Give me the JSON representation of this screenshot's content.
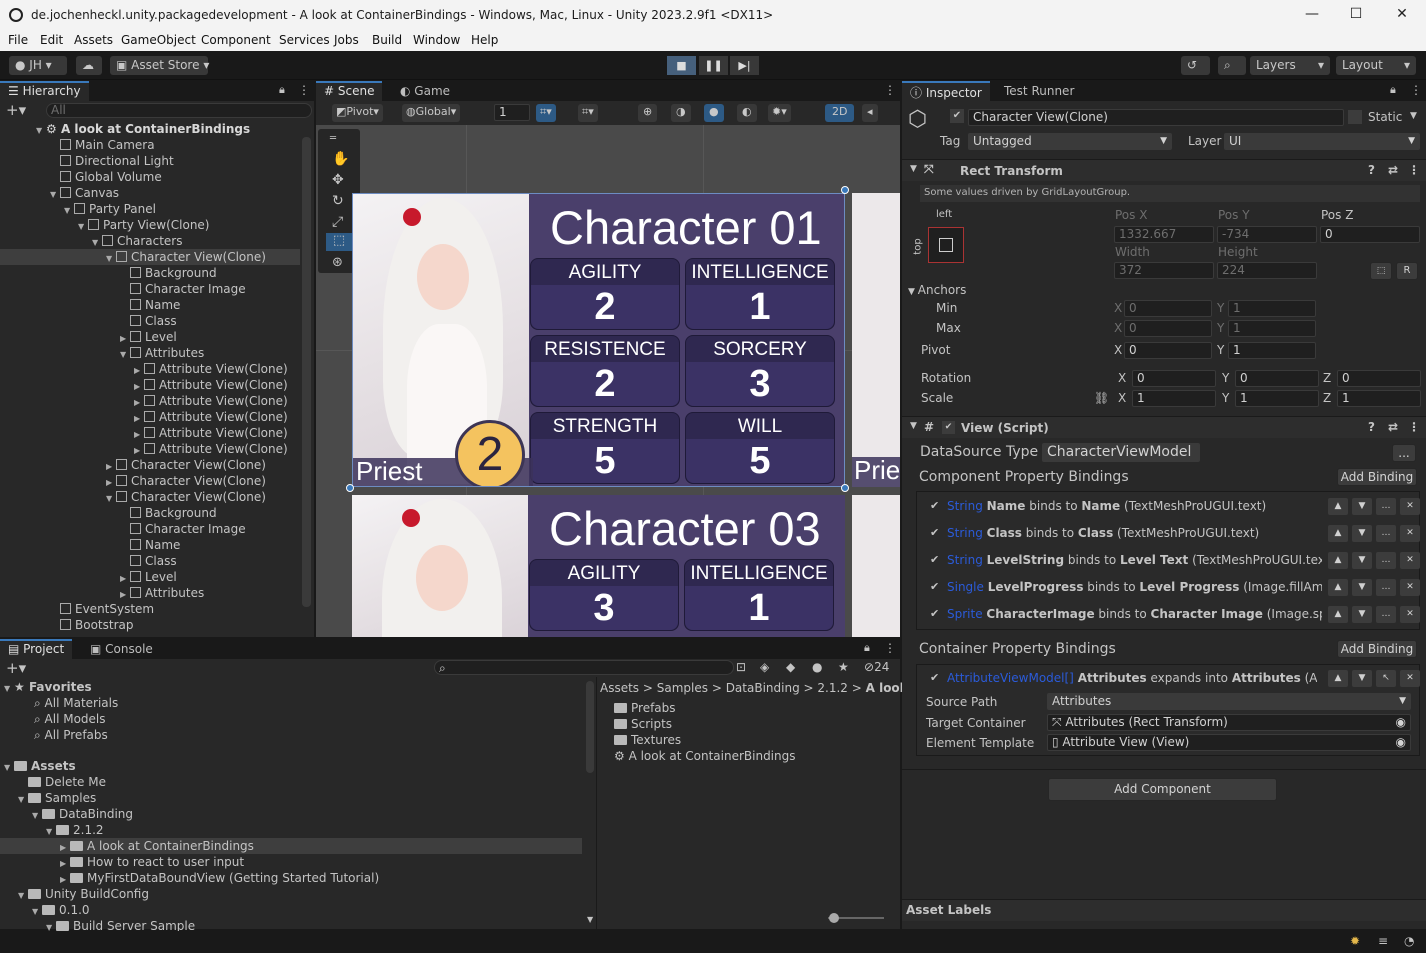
{
  "window": {
    "title": "de.jochenheckl.unity.packagedevelopment - A look at ContainerBindings - Windows, Mac, Linux - Unity 2023.2.9f1 <DX11>",
    "min": "—",
    "max": "☐",
    "close": "✕"
  },
  "menu": [
    "File",
    "Edit",
    "Assets",
    "GameObject",
    "Component",
    "Services",
    "Jobs",
    "Build",
    "Window",
    "Help"
  ],
  "toolbar": {
    "account": "JH",
    "asset_store": "Asset Store",
    "layers": "Layers",
    "layout": "Layout"
  },
  "hierarchy": {
    "tab": "Hierarchy",
    "search_placeholder": "All",
    "scene": "A look at ContainerBindings",
    "items": [
      {
        "label": "Main Camera",
        "depth": 1,
        "arrow": ""
      },
      {
        "label": "Directional Light",
        "depth": 1,
        "arrow": ""
      },
      {
        "label": "Global Volume",
        "depth": 1,
        "arrow": ""
      },
      {
        "label": "Canvas",
        "depth": 1,
        "arrow": "▼"
      },
      {
        "label": "Party Panel",
        "depth": 2,
        "arrow": "▼"
      },
      {
        "label": "Party View(Clone)",
        "depth": 3,
        "arrow": "▼"
      },
      {
        "label": "Characters",
        "depth": 4,
        "arrow": "▼"
      },
      {
        "label": "Character View(Clone)",
        "depth": 5,
        "arrow": "▼",
        "selected": true
      },
      {
        "label": "Background",
        "depth": 6,
        "arrow": ""
      },
      {
        "label": "Character Image",
        "depth": 6,
        "arrow": ""
      },
      {
        "label": "Name",
        "depth": 6,
        "arrow": ""
      },
      {
        "label": "Class",
        "depth": 6,
        "arrow": ""
      },
      {
        "label": "Level",
        "depth": 6,
        "arrow": "▶"
      },
      {
        "label": "Attributes",
        "depth": 6,
        "arrow": "▼"
      },
      {
        "label": "Attribute View(Clone)",
        "depth": 7,
        "arrow": "▶"
      },
      {
        "label": "Attribute View(Clone)",
        "depth": 7,
        "arrow": "▶"
      },
      {
        "label": "Attribute View(Clone)",
        "depth": 7,
        "arrow": "▶"
      },
      {
        "label": "Attribute View(Clone)",
        "depth": 7,
        "arrow": "▶"
      },
      {
        "label": "Attribute View(Clone)",
        "depth": 7,
        "arrow": "▶"
      },
      {
        "label": "Attribute View(Clone)",
        "depth": 7,
        "arrow": "▶"
      },
      {
        "label": "Character View(Clone)",
        "depth": 5,
        "arrow": "▶"
      },
      {
        "label": "Character View(Clone)",
        "depth": 5,
        "arrow": "▶"
      },
      {
        "label": "Character View(Clone)",
        "depth": 5,
        "arrow": "▼"
      },
      {
        "label": "Background",
        "depth": 6,
        "arrow": ""
      },
      {
        "label": "Character Image",
        "depth": 6,
        "arrow": ""
      },
      {
        "label": "Name",
        "depth": 6,
        "arrow": ""
      },
      {
        "label": "Class",
        "depth": 6,
        "arrow": ""
      },
      {
        "label": "Level",
        "depth": 6,
        "arrow": "▶"
      },
      {
        "label": "Attributes",
        "depth": 6,
        "arrow": "▶"
      },
      {
        "label": "EventSystem",
        "depth": 1,
        "arrow": ""
      },
      {
        "label": "Bootstrap",
        "depth": 1,
        "arrow": ""
      }
    ]
  },
  "scene": {
    "tab_scene": "Scene",
    "tab_game": "Game",
    "pivot": "Pivot",
    "global": "Global",
    "grid_value": "1",
    "mode_2d": "2D",
    "cards": [
      {
        "title": "Character 01",
        "class": "Priest",
        "level": "2",
        "stats": [
          {
            "k": "AGILITY",
            "v": "2"
          },
          {
            "k": "INTELLIGENCE",
            "v": "1"
          },
          {
            "k": "RESISTENCE",
            "v": "2"
          },
          {
            "k": "SORCERY",
            "v": "3"
          },
          {
            "k": "STRENGTH",
            "v": "5"
          },
          {
            "k": "WILL",
            "v": "5"
          }
        ]
      },
      {
        "title": "Character 03",
        "stats": [
          {
            "k": "AGILITY",
            "v": "3"
          },
          {
            "k": "INTELLIGENCE",
            "v": "1"
          }
        ]
      }
    ],
    "side_class": "Prie"
  },
  "project": {
    "tab_project": "Project",
    "tab_console": "Console",
    "hidden_count": "24",
    "favorites_label": "Favorites",
    "favorites": [
      "All Materials",
      "All Models",
      "All Prefabs"
    ],
    "assets_label": "Assets",
    "tree": [
      {
        "label": "Delete Me",
        "depth": 1,
        "arrow": ""
      },
      {
        "label": "Samples",
        "depth": 1,
        "arrow": "▼"
      },
      {
        "label": "DataBinding",
        "depth": 2,
        "arrow": "▼"
      },
      {
        "label": "2.1.2",
        "depth": 3,
        "arrow": "▼"
      },
      {
        "label": "A look at ContainerBindings",
        "depth": 4,
        "arrow": "▶",
        "selected": true
      },
      {
        "label": "How to react to user input",
        "depth": 4,
        "arrow": "▶"
      },
      {
        "label": "MyFirstDataBoundView (Getting Started Tutorial)",
        "depth": 4,
        "arrow": "▶"
      },
      {
        "label": "Unity BuildConfig",
        "depth": 1,
        "arrow": "▼"
      },
      {
        "label": "0.1.0",
        "depth": 2,
        "arrow": "▼"
      },
      {
        "label": "Build Server Sample",
        "depth": 3,
        "arrow": "▼"
      }
    ],
    "breadcrumb": [
      "Assets",
      "Samples",
      "DataBinding",
      "2.1.2",
      "A look"
    ],
    "files": [
      {
        "label": "Prefabs",
        "type": "folder"
      },
      {
        "label": "Scripts",
        "type": "folder"
      },
      {
        "label": "Textures",
        "type": "folder"
      },
      {
        "label": "A look at ContainerBindings",
        "type": "scene"
      }
    ]
  },
  "inspector": {
    "tab_inspector": "Inspector",
    "tab_test": "Test Runner",
    "object_name": "Character View(Clone)",
    "static_label": "Static",
    "tag_label": "Tag",
    "tag_value": "Untagged",
    "layer_label": "Layer",
    "layer_value": "UI",
    "rect": {
      "header": "Rect Transform",
      "note": "Some values driven by GridLayoutGroup.",
      "anchor_h": "left",
      "anchor_v": "top",
      "posx_label": "Pos X",
      "posy_label": "Pos Y",
      "posz_label": "Pos Z",
      "posx": "1332.667",
      "posy": "-734",
      "posz": "0",
      "width_label": "Width",
      "height_label": "Height",
      "width": "372",
      "height": "224",
      "r_btn": "R",
      "anchors_label": "Anchors",
      "min_label": "Min",
      "max_label": "Max",
      "min_x": "0",
      "min_y": "1",
      "max_x": "0",
      "max_y": "1",
      "pivot_label": "Pivot",
      "pivot_x": "0",
      "pivot_y": "1",
      "rotation_label": "Rotation",
      "rot_x": "0",
      "rot_y": "0",
      "rot_z": "0",
      "scale_label": "Scale",
      "scale_x": "1",
      "scale_y": "1",
      "scale_z": "1",
      "x": "X",
      "y": "Y",
      "z": "Z"
    },
    "view": {
      "header": "View (Script)",
      "datasource_label": "DataSource Type",
      "datasource_value": "CharacterViewModel",
      "more": "...",
      "component_label": "Component Property Bindings",
      "add_binding": "Add Binding",
      "bindings": [
        {
          "type": "String",
          "name": "Name",
          "binds": "binds to",
          "target": "Name",
          "detail": "(TextMeshProUGUI.text)"
        },
        {
          "type": "String",
          "name": "Class",
          "binds": "binds to",
          "target": "Class",
          "detail": "(TextMeshProUGUI.text)"
        },
        {
          "type": "String",
          "name": "LevelString",
          "binds": "binds to",
          "target": "Level Text",
          "detail": "(TextMeshProUGUI.text)"
        },
        {
          "type": "Single",
          "name": "LevelProgress",
          "binds": "binds to",
          "target": "Level Progress",
          "detail": "(Image.fillAmount)"
        },
        {
          "type": "Sprite",
          "name": "CharacterImage",
          "binds": "binds to",
          "target": "Character Image",
          "detail": "(Image.sprite)"
        }
      ],
      "container_label": "Container Property Bindings",
      "container_binding": {
        "type": "AttributeViewModel[]",
        "name": "Attributes",
        "binds": "expands into",
        "target": "Attributes",
        "detail": "(Attribut"
      },
      "source_path_label": "Source Path",
      "source_path": "Attributes",
      "target_container_label": "Target Container",
      "target_container": "Attributes (Rect Transform)",
      "element_template_label": "Element Template",
      "element_template": "Attribute View (View)"
    },
    "add_component": "Add Component",
    "asset_labels": "Asset Labels"
  },
  "colors": {
    "accent": "#3a79bb",
    "selected_row": "#2c5d87",
    "card": "#4a3f6b",
    "binding_type": "#2b5bd9"
  }
}
